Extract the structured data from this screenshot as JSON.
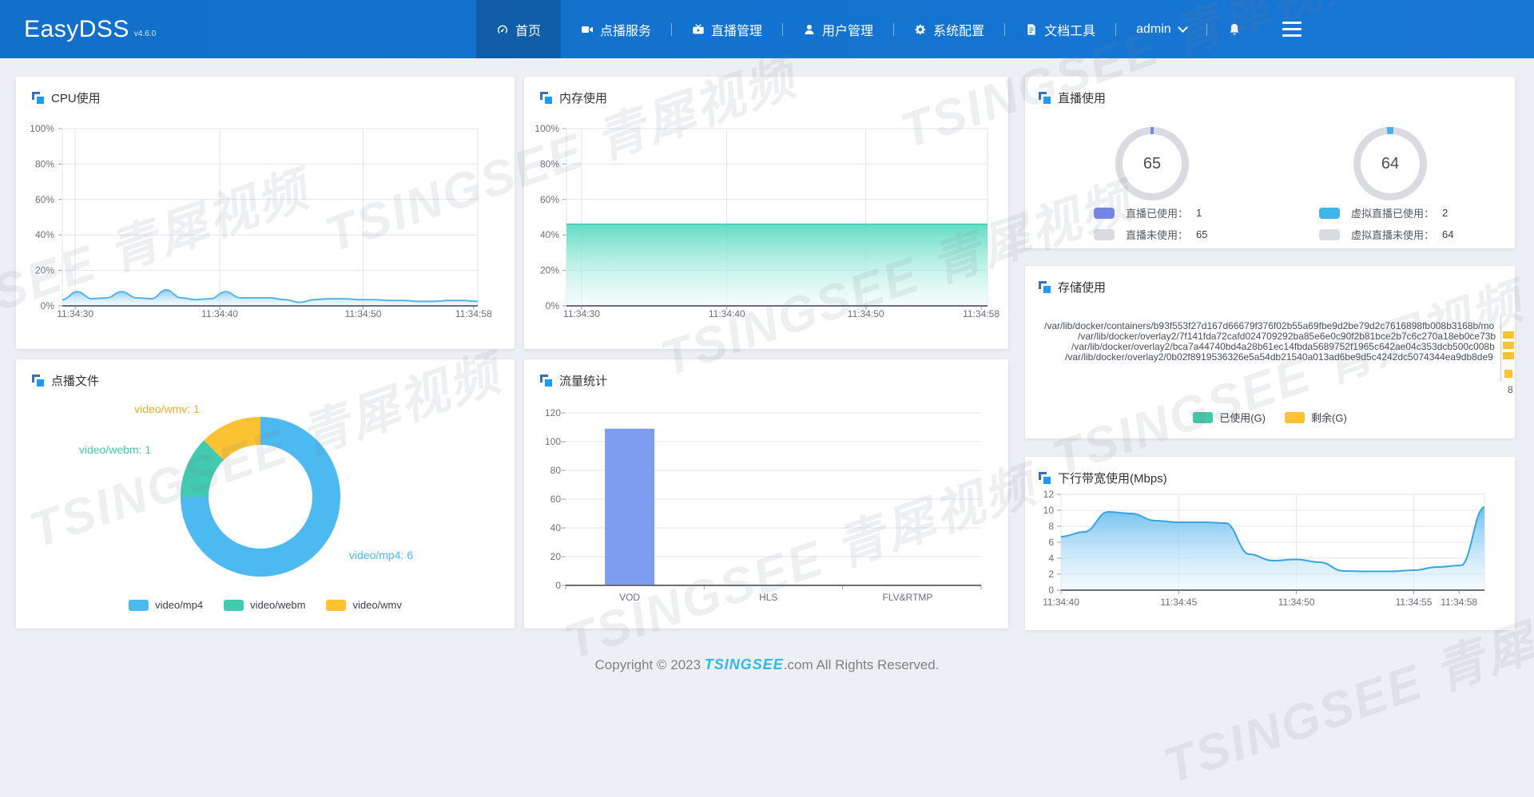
{
  "navbar": {
    "logo": "EasyDSS",
    "version": "v4.6.0",
    "items": [
      {
        "label": "首页",
        "icon": "dashboard-icon",
        "active": true
      },
      {
        "label": "点播服务",
        "icon": "vod-camera-icon",
        "active": false
      },
      {
        "label": "直播管理",
        "icon": "live-tv-icon",
        "active": false
      },
      {
        "label": "用户管理",
        "icon": "user-icon",
        "active": false
      },
      {
        "label": "系统配置",
        "icon": "gear-icon",
        "active": false
      },
      {
        "label": "文档工具",
        "icon": "document-icon",
        "active": false
      }
    ],
    "user": "admin"
  },
  "cards": {
    "cpu": {
      "title": "CPU使用",
      "chart_data": {
        "type": "area",
        "title": "CPU使用",
        "ymax": 100,
        "y_ticks": [
          "100%",
          "80%",
          "60%",
          "40%",
          "20%",
          "0%"
        ],
        "x_ticks": [
          "11:34:30",
          "11:34:40",
          "11:34:50",
          "11:34:58"
        ],
        "values": [
          3.5,
          8,
          4,
          4.5,
          8,
          4.5,
          4,
          9,
          4.5,
          3.5,
          4,
          8,
          4.5,
          4.5,
          4.5,
          3.5,
          2,
          3.5,
          4,
          4,
          3.5,
          3.5,
          3,
          3,
          2.5,
          2.5,
          3,
          3,
          2.5
        ],
        "line_color": "#56b4ea",
        "fill_top": "#7cc6ef",
        "fill_bottom": "#e8f5fd"
      }
    },
    "memory": {
      "title": "内存使用",
      "chart_data": {
        "type": "area",
        "title": "内存使用",
        "ymax": 100,
        "y_ticks": [
          "100%",
          "80%",
          "60%",
          "40%",
          "20%",
          "0%"
        ],
        "x_ticks": [
          "11:34:30",
          "11:34:40",
          "11:34:50",
          "11:34:58"
        ],
        "values": [
          46,
          46,
          46,
          46,
          46,
          46,
          46,
          46
        ],
        "line_color": "#46d0b8",
        "fill_top": "#52d9c0",
        "fill_bottom": "#ecfaf7"
      }
    },
    "live": {
      "title": "直播使用",
      "gauges": [
        {
          "value": "65",
          "used": 1,
          "free": 65,
          "color": "#7585ea",
          "track": "#d9dbe0",
          "legend": [
            {
              "label": "直播已使用：",
              "value": "1"
            },
            {
              "label": "直播未使用：",
              "value": "65"
            }
          ]
        },
        {
          "value": "64",
          "used": 2,
          "free": 64,
          "color": "#41b4ea",
          "track": "#d9dbe0",
          "legend": [
            {
              "label": "虚拟直播已使用：",
              "value": "2"
            },
            {
              "label": "虚拟直播未使用：",
              "value": "64"
            }
          ]
        }
      ]
    },
    "storage": {
      "title": "存储使用",
      "paths": [
        "/var/lib/docker/containers/b93f553f27d167d66679f376f02b55a69fbe9d2be79d2c7616898fb008b3168b/mo",
        "/var/lib/docker/overlay2/7f141fda72cafd024709292ba85e6e0c90f2b81bce2b7c6c270a18eb0ce73b",
        "/var/lib/docker/overlay2/bca7a44740bd4a28b61ec14fbda5689752f1965c642ae04c353dcb500c008b",
        "/var/lib/docker/overlay2/0b02f8919536326e5a54db21540a013ad6be9d5c4242dc5074344ea9db8de9"
      ],
      "partial_label": "8",
      "bar_color": "#fdc231",
      "legend": [
        {
          "label": "已使用(G)",
          "color": "#41c8a8"
        },
        {
          "label": "剩余(G)",
          "color": "#fdc231"
        }
      ]
    },
    "vod_files": {
      "title": "点播文件",
      "chart_data": {
        "type": "donut",
        "title": "点播文件",
        "slices": [
          {
            "label": "video/mp4",
            "value": 6,
            "color": "#4db9f1"
          },
          {
            "label": "video/webm",
            "value": 1,
            "color": "#41cbb0"
          },
          {
            "label": "video/wmv",
            "value": 1,
            "color": "#fdc231"
          }
        ],
        "callouts": [
          {
            "text": "video/wmv: 1",
            "color": "#f0ad27"
          },
          {
            "text": "video/webm: 1",
            "color": "#41cbb0"
          },
          {
            "text": "video/mp4: 6",
            "color": "#4db9f1"
          }
        ]
      }
    },
    "traffic": {
      "title": "流量统计",
      "chart_data": {
        "type": "bar",
        "title": "流量统计",
        "categories": [
          "VOD",
          "HLS",
          "FLV&RTMP"
        ],
        "values": [
          109,
          0,
          0
        ],
        "ymax": 120,
        "y_ticks": [
          "120",
          "100",
          "80",
          "60",
          "40",
          "20",
          "0"
        ],
        "bar_color": "#7d9df1"
      }
    },
    "bandwidth": {
      "title": "下行带宽使用(Mbps)",
      "chart_data": {
        "type": "area",
        "title": "下行带宽使用(Mbps)",
        "ymax": 12,
        "y_ticks": [
          "12",
          "10",
          "8",
          "6",
          "4",
          "2",
          "0"
        ],
        "x_ticks": [
          "11:34:40",
          "11:34:45",
          "11:34:50",
          "11:34:55",
          "11:34:58"
        ],
        "values": [
          6.7,
          7.3,
          9.8,
          9.6,
          8.7,
          8.5,
          8.5,
          8.4,
          4.5,
          3.7,
          3.85,
          3.5,
          2.4,
          2.35,
          2.35,
          2.5,
          2.9,
          3.1,
          10.4
        ],
        "line_color": "#3aa4e0",
        "fill_top": "#5fb9ee",
        "fill_bottom": "#e8f5fd"
      }
    }
  },
  "footer": {
    "prefix": "Copyright © 2023 ",
    "brand": "TSINGSEE",
    "suffix": ".com All Rights Reserved."
  },
  "watermark": "TSINGSEE 青犀视频"
}
